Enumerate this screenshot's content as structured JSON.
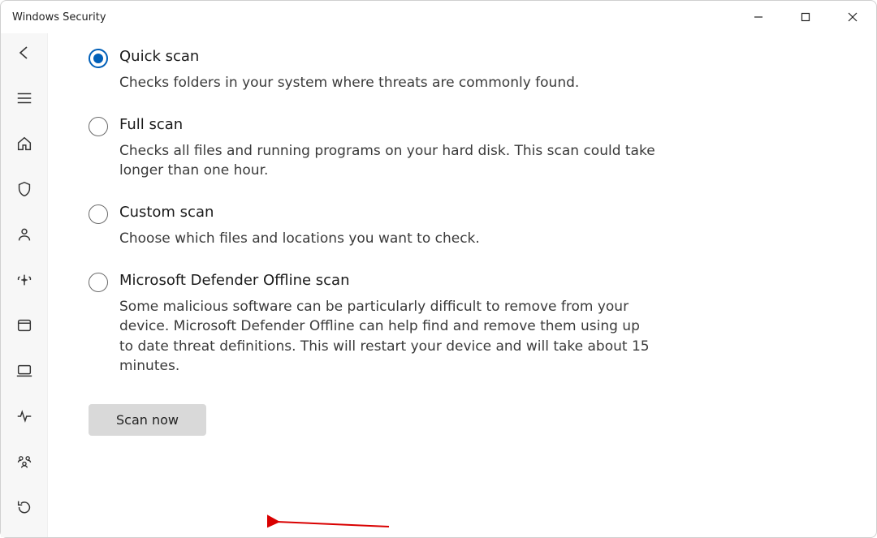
{
  "window": {
    "title": "Windows Security"
  },
  "options": [
    {
      "id": "quick",
      "title": "Quick scan",
      "desc": "Checks folders in your system where threats are commonly found.",
      "selected": true
    },
    {
      "id": "full",
      "title": "Full scan",
      "desc": "Checks all files and running programs on your hard disk. This scan could take longer than one hour.",
      "selected": false
    },
    {
      "id": "custom",
      "title": "Custom scan",
      "desc": "Choose which files and locations you want to check.",
      "selected": false
    },
    {
      "id": "offline",
      "title": "Microsoft Defender Offline scan",
      "desc": "Some malicious software can be particularly difficult to remove from your device. Microsoft Defender Offline can help find and remove them using up to date threat definitions. This will restart your device and will take about 15 minutes.",
      "selected": false
    }
  ],
  "actions": {
    "scan": "Scan now"
  },
  "colors": {
    "accent": "#005fb8",
    "annotation": "#d90000"
  }
}
